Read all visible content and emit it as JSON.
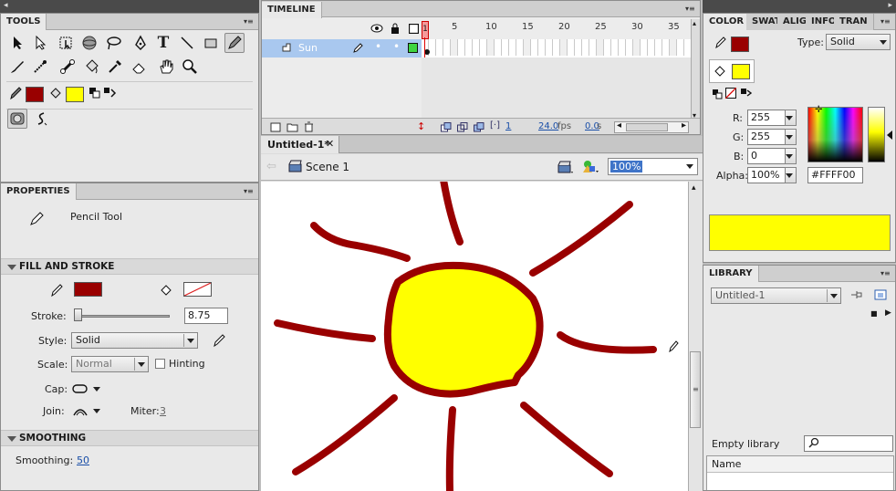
{
  "tools_panel": {
    "title": "TOOLS"
  },
  "properties_panel": {
    "title": "PROPERTIES",
    "tool_name": "Pencil Tool",
    "fill_stroke_header": "FILL AND STROKE",
    "stroke_label": "Stroke:",
    "stroke_value": "8.75",
    "stroke_slider_fraction": 0.0,
    "style_label": "Style:",
    "style_value": "Solid",
    "scale_label": "Scale:",
    "scale_value": "Normal",
    "hinting_label": "Hinting",
    "cap_label": "Cap:",
    "join_label": "Join:",
    "miter_label": "Miter:",
    "miter_value": "3",
    "smoothing_header": "SMOOTHING",
    "smoothing_label": "Smoothing:",
    "smoothing_value": "50",
    "stroke_color": "#990000",
    "fill_color": "#ffff00"
  },
  "timeline": {
    "title": "TIMELINE",
    "frame_numbers": [
      "1",
      "5",
      "10",
      "15",
      "20",
      "25",
      "30",
      "35"
    ],
    "layer_name": "Sun",
    "current_frame": "1",
    "fps": "24.0",
    "fps_unit": "fps",
    "elapsed": "0.0",
    "elapsed_unit": "s"
  },
  "document": {
    "tab_label": "Untitled-1*",
    "scene_label": "Scene 1",
    "zoom_value": "100%"
  },
  "color_panel": {
    "tabs": [
      "COLOR",
      "SWAT",
      "ALIGN",
      "INFO",
      "TRAN"
    ],
    "type_label": "Type:",
    "type_value": "Solid",
    "r_label": "R:",
    "r_value": "255",
    "g_label": "G:",
    "g_value": "255",
    "b_label": "B:",
    "b_value": "0",
    "alpha_label": "Alpha:",
    "alpha_value": "100%",
    "hex_value": "#FFFF00",
    "preview_color": "#ffff00",
    "stroke_color": "#990000",
    "fill_color": "#ffff00"
  },
  "library_panel": {
    "title": "LIBRARY",
    "document_select": "Untitled-1",
    "empty_label": "Empty library",
    "name_column": "Name"
  },
  "drawing": {
    "sun_fill": "#ffff00",
    "ray_color": "#990000"
  }
}
